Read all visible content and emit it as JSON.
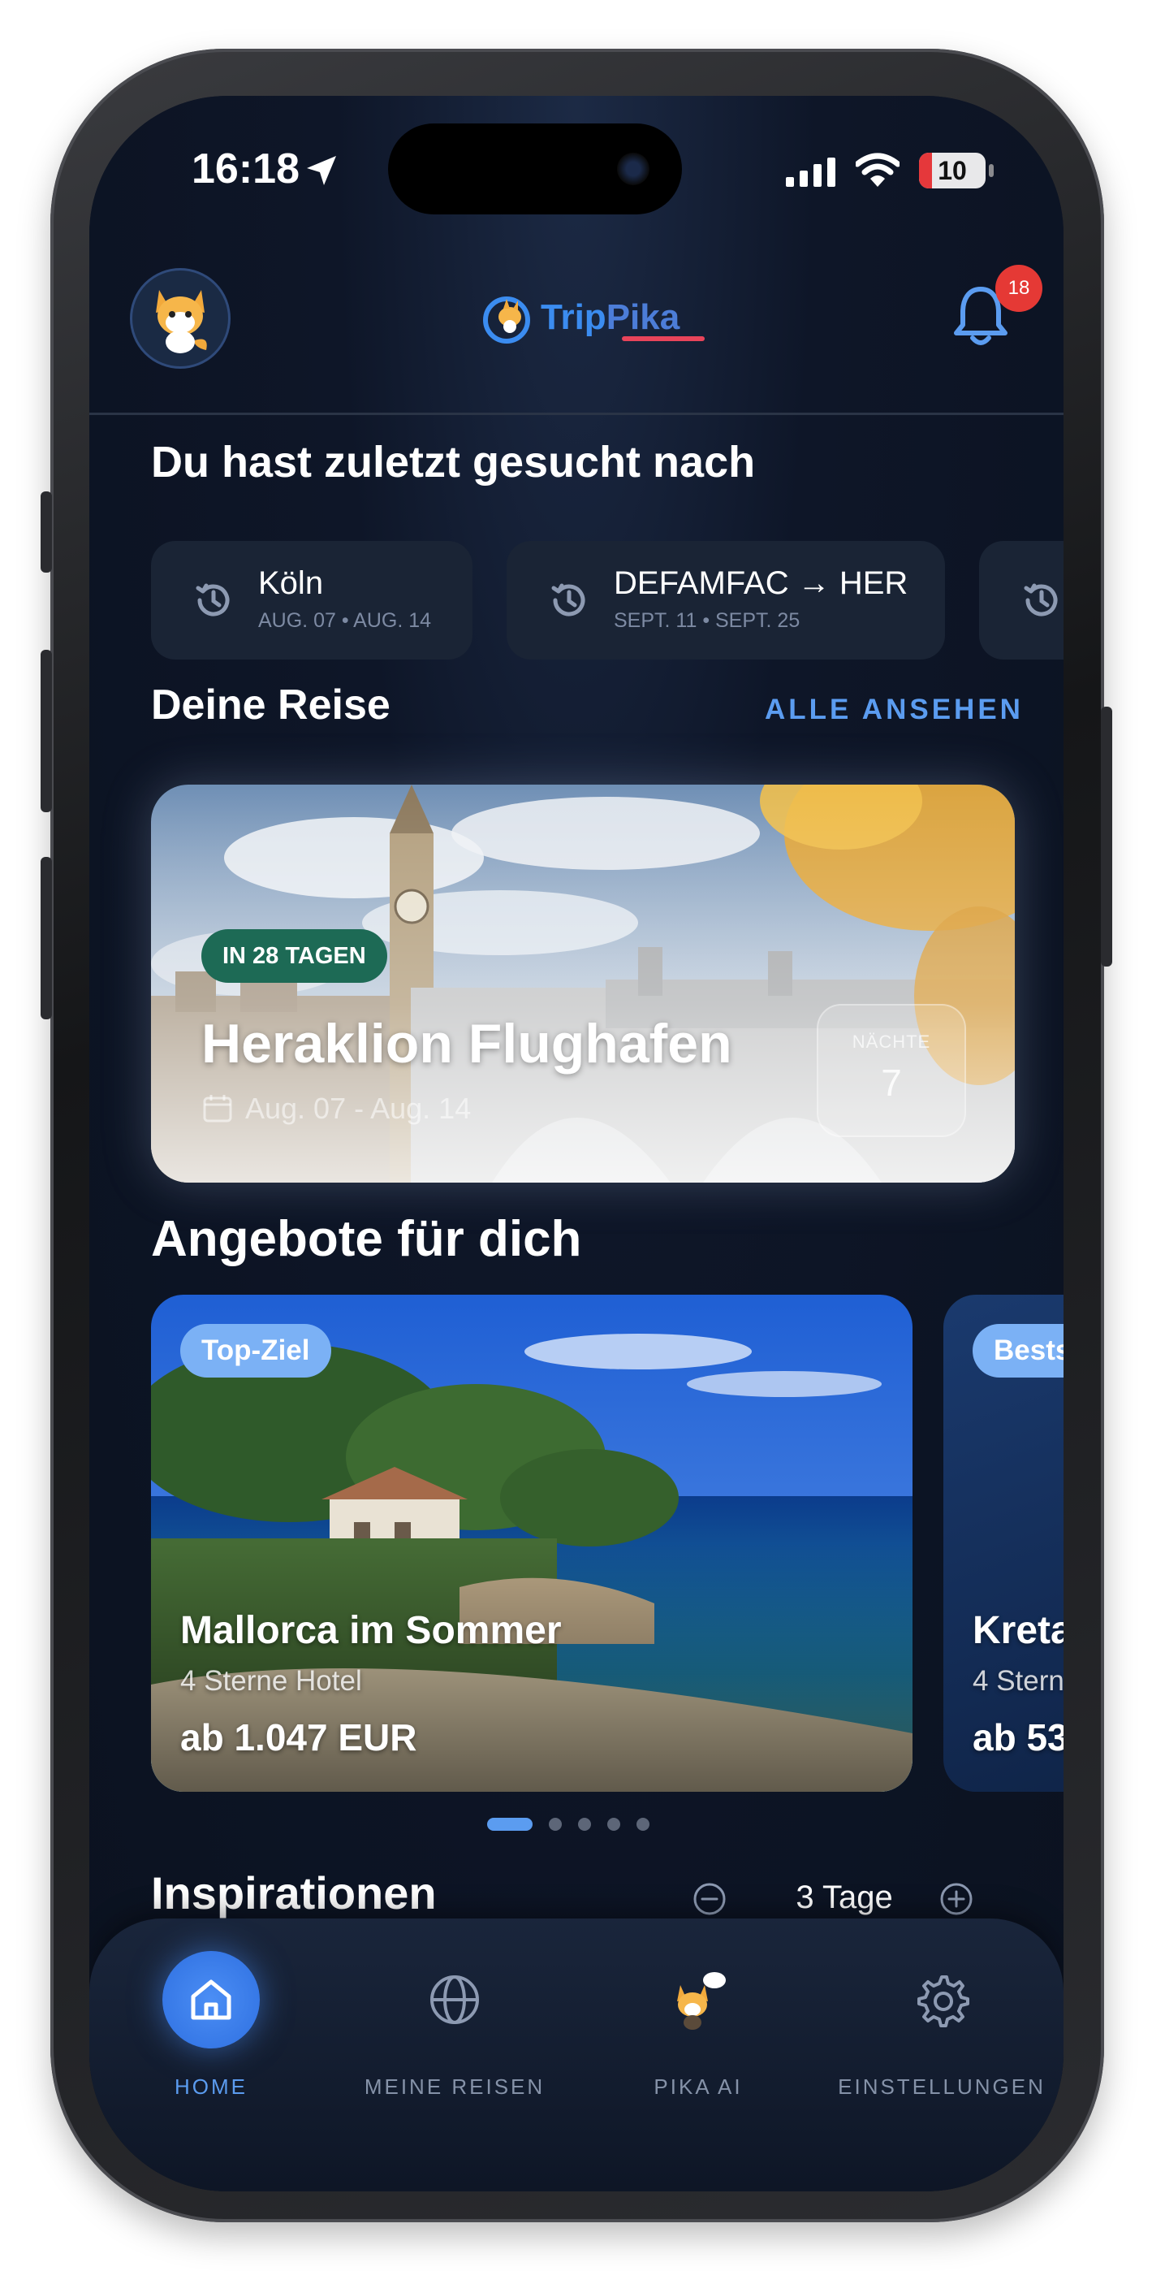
{
  "status_bar": {
    "time": "16:18",
    "battery": "10"
  },
  "header": {
    "logo_trip": "Trip",
    "logo_pika": "Pika",
    "notification_count": "18"
  },
  "recent_searches": {
    "title": "Du hast zuletzt gesucht nach",
    "items": [
      {
        "title": "Köln",
        "dates": "AUG. 07 • AUG. 14"
      },
      {
        "title": "DEFAMFAC → HER",
        "dates": "SEPT. 11 • SEPT. 25"
      }
    ]
  },
  "trip": {
    "section_title": "Deine Reise",
    "see_all": "ALLE ANSEHEN",
    "badge": "IN 28 TAGEN",
    "title": "Heraklion Flughafen",
    "dates": "Aug. 07 - Aug. 14",
    "nights_label": "NÄCHTE",
    "nights_value": "7"
  },
  "offers": {
    "section_title": "Angebote für dich",
    "items": [
      {
        "tag": "Top-Ziel",
        "title": "Mallorca im Sommer",
        "subtitle": "4 Sterne Hotel",
        "price": "ab 1.047 EUR"
      },
      {
        "tag": "Bests",
        "title": "Kreta",
        "subtitle": "4 Stern",
        "price": "ab 53"
      }
    ],
    "page_count": 5,
    "active_page": 1
  },
  "inspirations": {
    "title": "Inspirationen",
    "duration": "3 Tage"
  },
  "bottom_nav": {
    "items": [
      {
        "label": "HOME",
        "icon": "home-icon",
        "active": true
      },
      {
        "label": "MEINE REISEN",
        "icon": "globe-icon",
        "active": false
      },
      {
        "label": "PIKA AI",
        "icon": "pika-mascot-icon",
        "active": false
      },
      {
        "label": "EINSTELLUNGEN",
        "icon": "gear-icon",
        "active": false
      }
    ]
  },
  "colors": {
    "accent": "#5b9cf0",
    "background": "#0d1424",
    "badge_green": "#1d6a55",
    "notification_red": "#e53935"
  }
}
